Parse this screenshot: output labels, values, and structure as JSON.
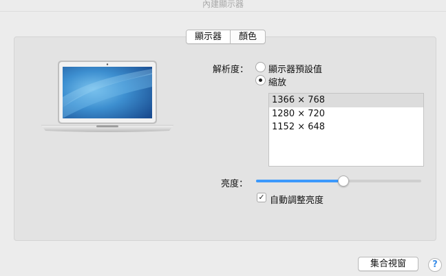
{
  "window": {
    "title": "內建顯示器"
  },
  "tabs": [
    {
      "label": "顯示器",
      "active": true
    },
    {
      "label": "顏色",
      "active": false
    }
  ],
  "resolution": {
    "label": "解析度：",
    "options": [
      {
        "label": "顯示器預設值",
        "selected": false
      },
      {
        "label": "縮放",
        "selected": true
      }
    ],
    "list": [
      "1366 × 768",
      "1280 × 720",
      "1152 × 648"
    ],
    "selected_index": 0
  },
  "brightness": {
    "label": "亮度：",
    "level_percent": 53,
    "auto_label": "自動調整亮度",
    "auto_checked": true
  },
  "footer": {
    "arrange_button": "集合視窗",
    "help_button": "?"
  },
  "colors": {
    "accent": "#3b99fc"
  },
  "icons": {
    "laptop": "macbook-air-icon",
    "help": "question-mark-icon",
    "check": "checkmark-icon"
  }
}
